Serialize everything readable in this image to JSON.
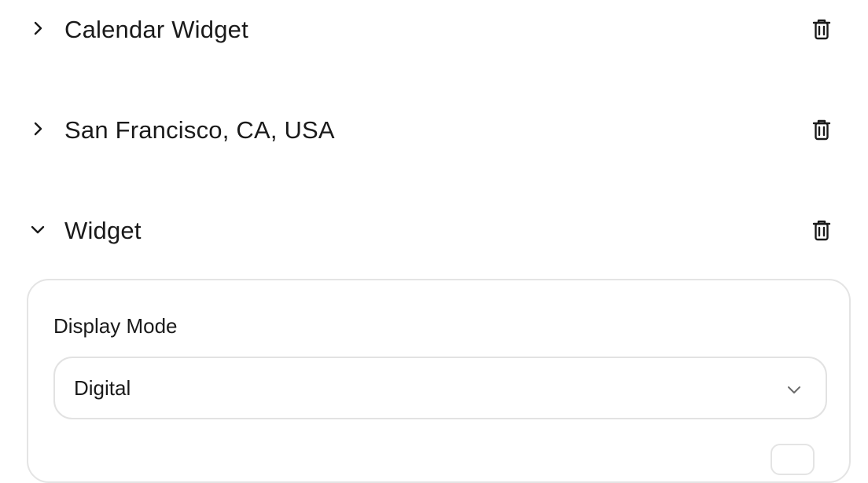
{
  "items": [
    {
      "label": "Calendar Widget",
      "expanded": false,
      "chevron_icon": "chevron-right-icon",
      "delete_icon": "trash-icon"
    },
    {
      "label": "San Francisco, CA, USA",
      "expanded": false,
      "chevron_icon": "chevron-right-icon",
      "delete_icon": "trash-icon"
    },
    {
      "label": "Widget",
      "expanded": true,
      "chevron_icon": "chevron-down-icon",
      "delete_icon": "trash-icon"
    }
  ],
  "widget_panel": {
    "display_mode_label": "Display Mode",
    "display_mode_value": "Digital",
    "select_icon": "chevron-down-icon"
  },
  "colors": {
    "text": "#1a1a1a",
    "border": "#e4e4e4",
    "icon": "#1a1a1a",
    "select_chevron": "#6b6b6b"
  }
}
